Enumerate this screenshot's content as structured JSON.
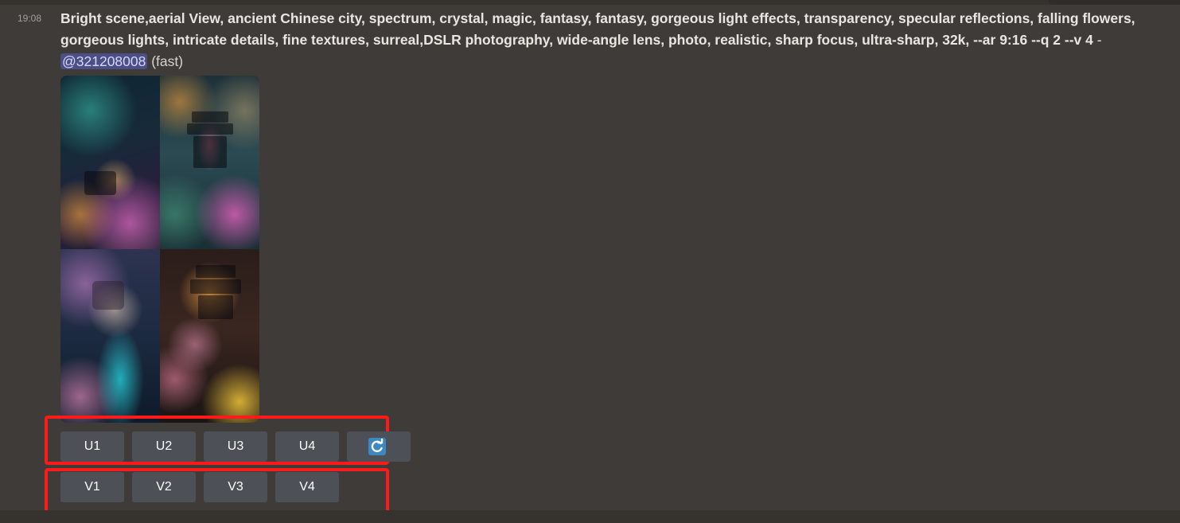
{
  "message": {
    "timestamp": "19:08",
    "prompt": "Bright scene,aerial View, ancient Chinese city, spectrum, crystal, magic, fantasy, fantasy, gorgeous light effects, transparency, specular reflections, falling flowers, gorgeous lights, intricate details, fine textures, surreal,DSLR photography, wide-angle lens, photo, realistic, sharp focus, ultra-sharp, 32k, --ar 9:16 --q 2 --v 4",
    "separator": " - ",
    "mention": "@321208008",
    "speed": " (fast)"
  },
  "upscale_buttons": [
    {
      "label": "U1"
    },
    {
      "label": "U2"
    },
    {
      "label": "U3"
    },
    {
      "label": "U4"
    }
  ],
  "variation_buttons": [
    {
      "label": "V1"
    },
    {
      "label": "V2"
    },
    {
      "label": "V3"
    },
    {
      "label": "V4"
    }
  ],
  "reroll_button": {
    "icon": "reroll-icon"
  },
  "colors": {
    "background": "#3f3b38",
    "button": "#4e5058",
    "mention_bg": "#4b4f86",
    "highlight": "#ff1a1a",
    "reroll_icon": "#3b88c3"
  }
}
